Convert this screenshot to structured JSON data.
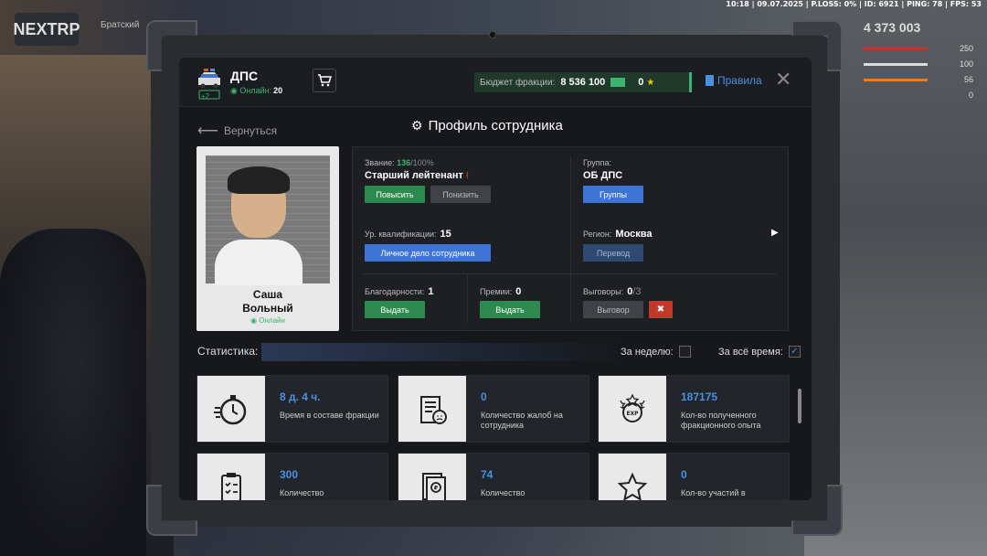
{
  "hud": {
    "topbar": "10:18 | 09.07.2025 | P.LOSS: 0% | ID: 6921 | PING: 78 | FPS: 53",
    "logo": "NEXTRP",
    "server": "Братский",
    "money": "4 373 003",
    "stats": [
      "250",
      "100",
      "56",
      "0"
    ]
  },
  "header": {
    "faction": "ДПС",
    "online_label": "Онлайн:",
    "online_count": "20",
    "badge": "+2",
    "budget_label": "Бюджет фракции:",
    "budget_value": "8 536 100",
    "stars": "0",
    "rules": "Правила"
  },
  "nav": {
    "back": "Вернуться",
    "title": "Профиль сотрудника"
  },
  "profile": {
    "first_name": "Саша",
    "last_name": "Вольный",
    "status": "Онлайн"
  },
  "info": {
    "rank_label": "Звание:",
    "rank_progress": "136",
    "rank_max": "/100%",
    "rank_name": "Старший лейтенант",
    "promote": "Повысить",
    "demote": "Понизить",
    "group_label": "Группа:",
    "group_name": "ОБ ДПС",
    "groups_btn": "Группы",
    "qual_label": "Ур. квалификации:",
    "qual_value": "15",
    "dossier_btn": "Личное дело сотрудника",
    "region_label": "Регион:",
    "region_value": "Москва",
    "transfer_btn": "Перевод",
    "thanks_label": "Благодарности:",
    "thanks_value": "1",
    "thanks_btn": "Выдать",
    "bonus_label": "Премии:",
    "bonus_value": "0",
    "bonus_btn": "Выдать",
    "reprimand_label": "Выговоры:",
    "reprimand_value": "0",
    "reprimand_max": "/3",
    "reprimand_btn": "Выговор"
  },
  "stats": {
    "label": "Статистика:",
    "week": "За неделю:",
    "all_time": "За всё время:",
    "cards": [
      {
        "value": "8 д. 4 ч.",
        "text": "Время в составе фракции"
      },
      {
        "value": "0",
        "text": "Количество жалоб на сотрудника"
      },
      {
        "value": "187175",
        "text": "Кол-во полученного фракционного опыта"
      },
      {
        "value": "300",
        "text": "Количество"
      },
      {
        "value": "74",
        "text": "Количество"
      },
      {
        "value": "0",
        "text": "Кол-во участий в"
      }
    ]
  },
  "colors": {
    "accent": "#4a90e2",
    "green": "#2d8a4e",
    "red": "#c0392b"
  }
}
